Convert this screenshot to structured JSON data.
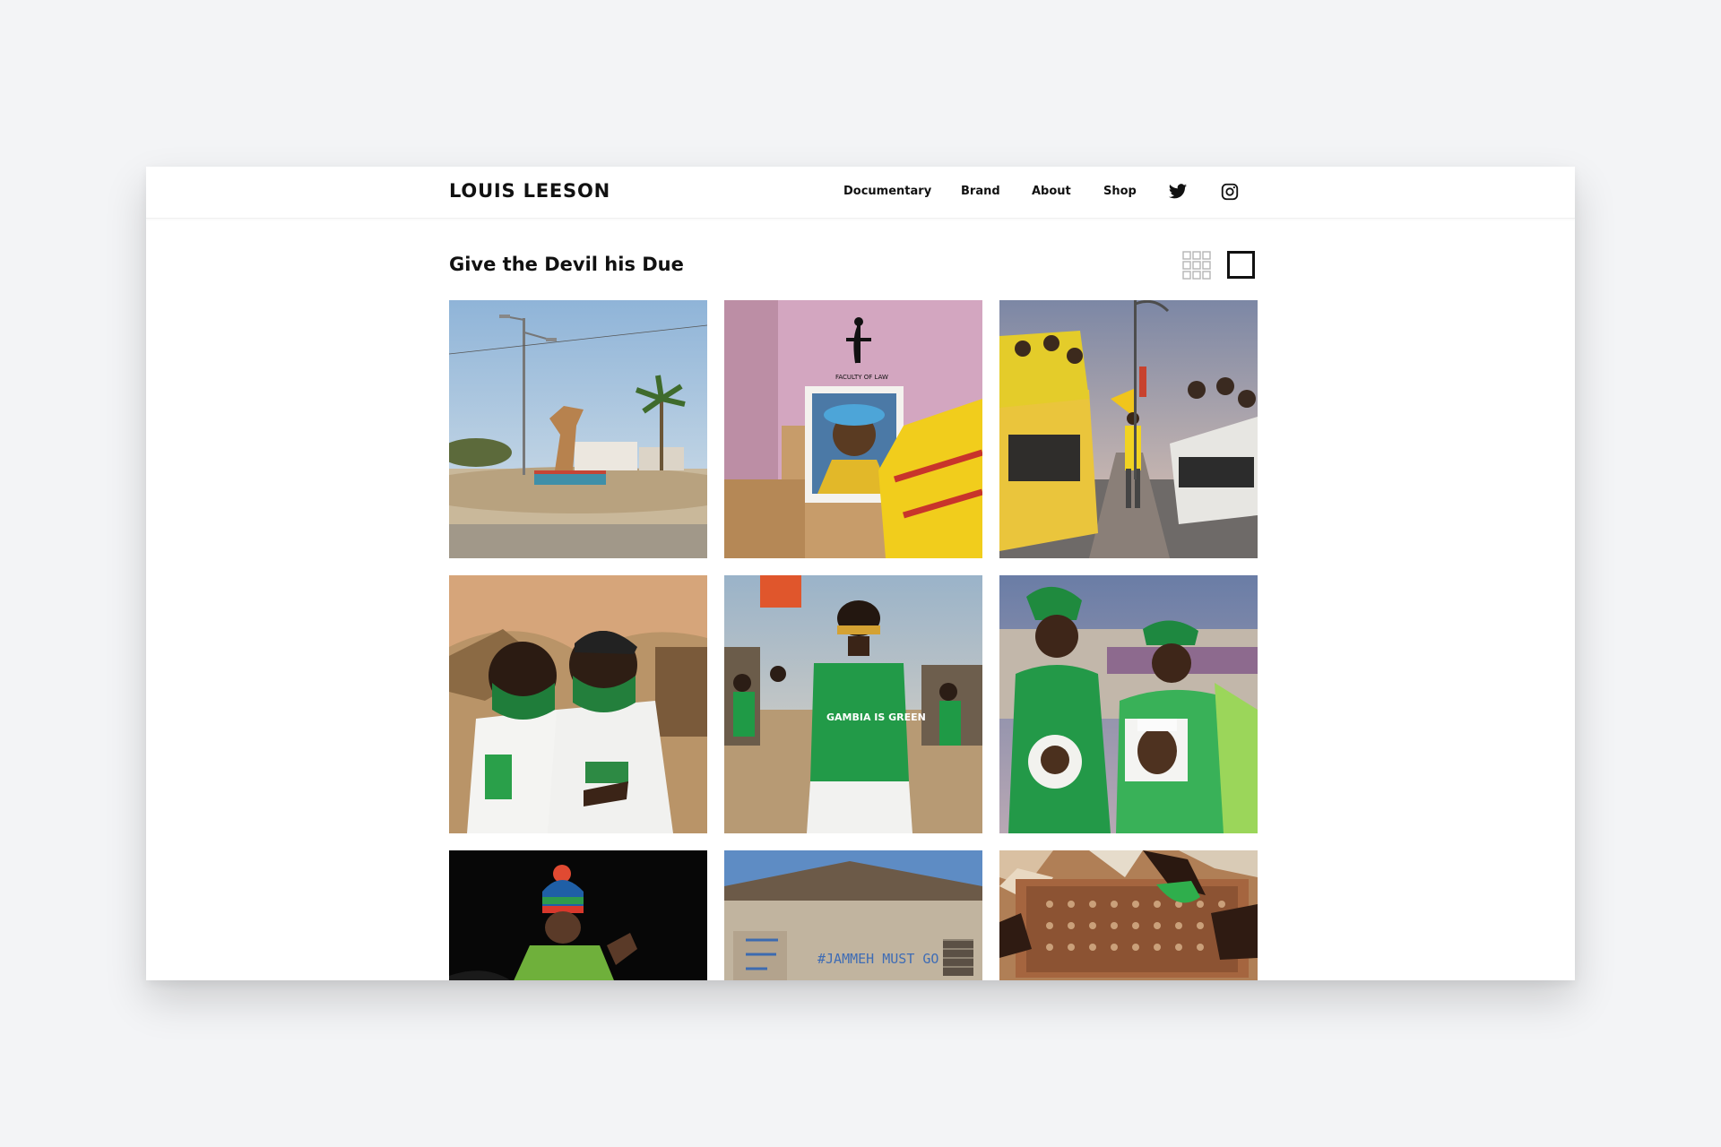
{
  "site": {
    "logo": "LOUIS LEESON",
    "nav": [
      {
        "label": "Documentary"
      },
      {
        "label": "Brand"
      },
      {
        "label": "About"
      },
      {
        "label": "Shop"
      }
    ],
    "social": [
      {
        "icon": "twitter-icon"
      },
      {
        "icon": "instagram-icon"
      }
    ]
  },
  "gallery": {
    "title": "Give the Devil his Due",
    "view_modes": [
      "grid-view-icon",
      "single-view-icon"
    ],
    "photos": [
      {
        "name": "photo-roundabout-statue",
        "text": ""
      },
      {
        "name": "photo-faculty-of-law-portrait",
        "text": "FACULTY OF LAW"
      },
      {
        "name": "photo-yellow-rally-convoy",
        "text": ""
      },
      {
        "name": "photo-masked-youths",
        "text": ""
      },
      {
        "name": "photo-gambia-is-green",
        "text": "GAMBIA IS GREEN"
      },
      {
        "name": "photo-women-in-green",
        "text": ""
      },
      {
        "name": "photo-man-in-bobble-hat",
        "text": ""
      },
      {
        "name": "photo-graffiti-wall",
        "text": "#JAMMEH MUST GO"
      },
      {
        "name": "photo-board-game-hands",
        "text": ""
      }
    ]
  },
  "colors": {
    "background": "#f3f4f6",
    "text": "#111111",
    "accent_green": "#1f9a46",
    "accent_yellow": "#f3d21c"
  }
}
